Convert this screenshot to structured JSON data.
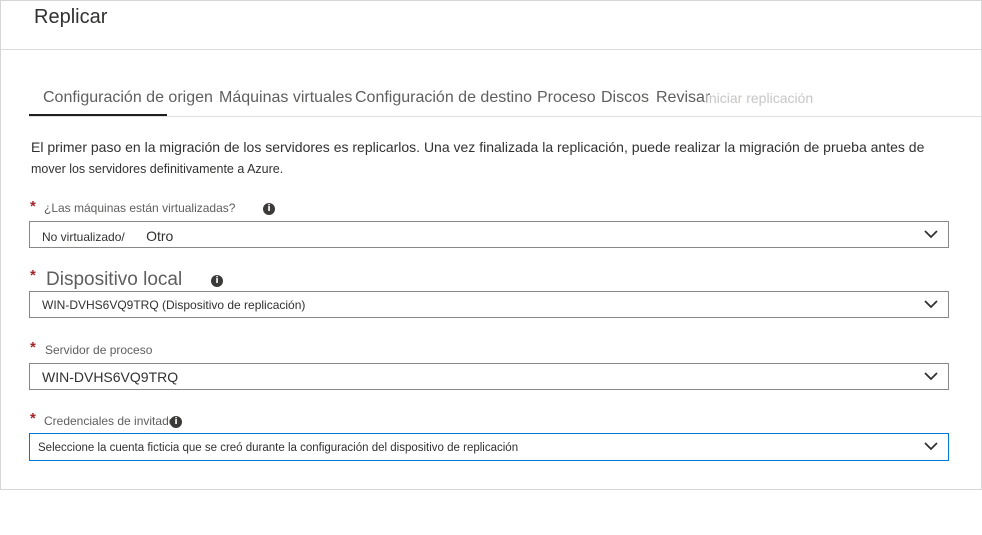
{
  "header": {
    "title": "Replicar"
  },
  "tabs": [
    {
      "label": "Configuración de origen",
      "active": true
    },
    {
      "label": "Máquinas virtuales"
    },
    {
      "label": "Configuración de destino"
    },
    {
      "label": "Proceso"
    },
    {
      "label": "Discos"
    },
    {
      "label": "Revisar"
    },
    {
      "label": "Iniciar replicación",
      "disabled": true
    }
  ],
  "intro": {
    "line1": "El primer paso en la migración de los servidores es replicarlos. Una vez finalizada la replicación, puede realizar la migración de prueba antes de",
    "line2": "mover los servidores definitivamente a Azure."
  },
  "fields": {
    "virtualized": {
      "label": "¿Las máquinas están virtualizadas?",
      "value_part1": "No virtualizado/",
      "value_part2": "Otro"
    },
    "appliance": {
      "label": "Dispositivo local",
      "value": "WIN-DVHS6VQ9TRQ (Dispositivo  de  replicación)"
    },
    "process_server": {
      "label": "Servidor de proceso",
      "value": "WIN-DVHS6VQ9TRQ"
    },
    "guest_credentials": {
      "label": "Credenciales de invitado",
      "value": "Seleccione la cuenta ficticia que se creó durante la configuración del dispositivo de replicación"
    }
  },
  "required_marker": "*",
  "info_glyph": "i",
  "colors": {
    "required": "#a4262c",
    "focus": "#0078d4",
    "active_tab_underline": "#1f1f1f"
  }
}
